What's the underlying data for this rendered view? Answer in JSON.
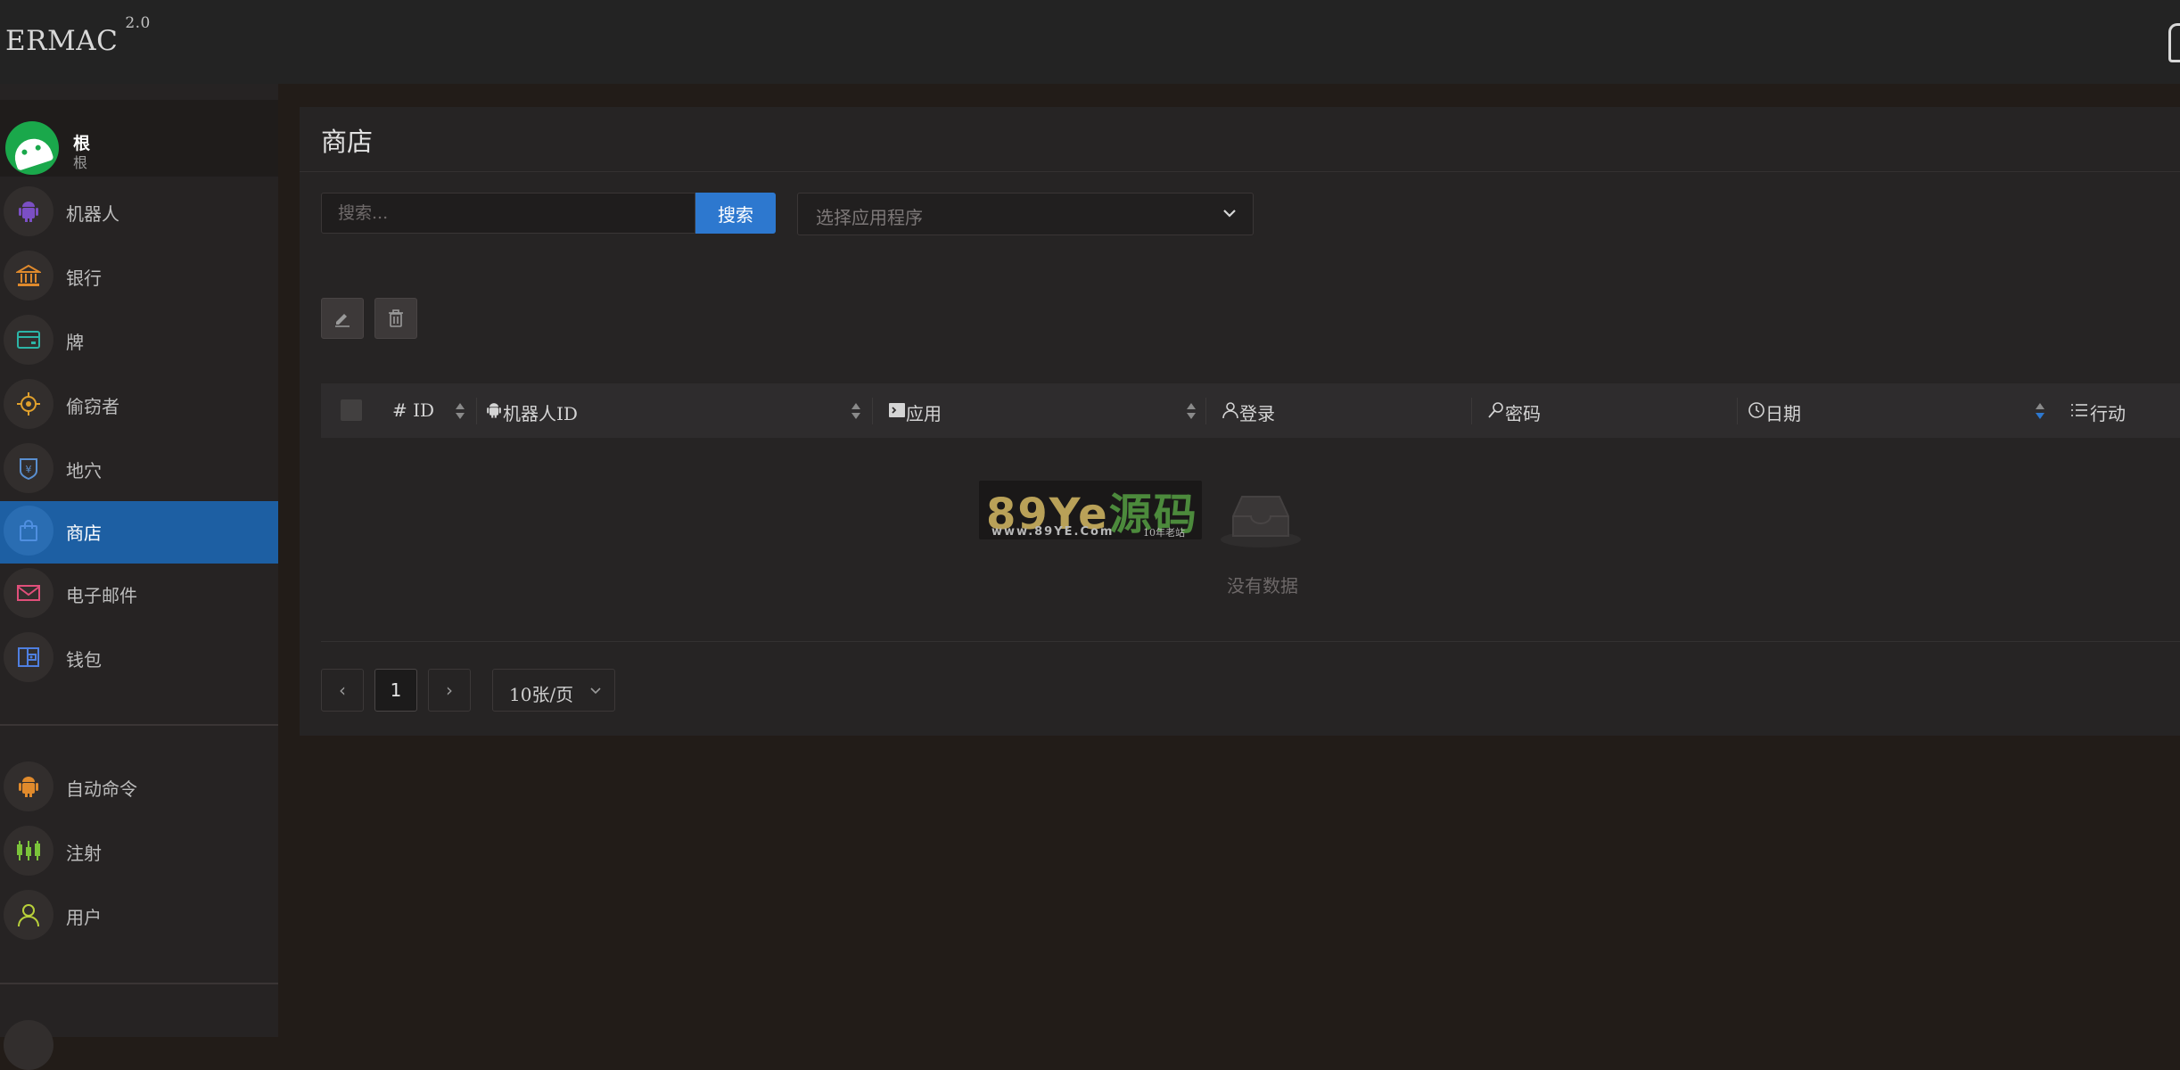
{
  "app": {
    "name": "ERMAC",
    "version": "2.0"
  },
  "profile": {
    "name": "根",
    "role": "根"
  },
  "sidebar": {
    "items": [
      {
        "label": "机器人",
        "icon": "android-icon",
        "color": "#7b4fc4"
      },
      {
        "label": "银行",
        "icon": "bank-icon",
        "color": "#e08a2c"
      },
      {
        "label": "牌",
        "icon": "card-icon",
        "color": "#2cb5a7"
      },
      {
        "label": "偷窃者",
        "icon": "target-icon",
        "color": "#e0a02c"
      },
      {
        "label": "地穴",
        "icon": "shield-yen-icon",
        "color": "#5a8fd0"
      },
      {
        "label": "商店",
        "icon": "shopping-bag-icon",
        "color": "#4f8fe0",
        "active": true
      },
      {
        "label": "电子邮件",
        "icon": "mail-icon",
        "color": "#e04f7a"
      },
      {
        "label": "钱包",
        "icon": "wallet-icon",
        "color": "#4f7fe0"
      }
    ],
    "items2": [
      {
        "label": "自动命令",
        "icon": "android-icon",
        "color": "#e08a2c"
      },
      {
        "label": "注射",
        "icon": "injection-icon",
        "color": "#7bc43a"
      },
      {
        "label": "用户",
        "icon": "user-icon",
        "color": "#b8d03a"
      }
    ]
  },
  "page": {
    "title": "商店"
  },
  "search": {
    "placeholder": "搜索...",
    "button": "搜索"
  },
  "app_select": {
    "placeholder": "选择应用程序"
  },
  "table": {
    "columns": [
      "ID",
      "机器人ID",
      "应用",
      "登录",
      "密码",
      "日期",
      "行动"
    ],
    "rows": [],
    "empty_text": "没有数据"
  },
  "watermark": {
    "main_a": "89Ye",
    "main_b": "源码",
    "url": "www.89YE.Com",
    "tag": "10年老站"
  },
  "pagination": {
    "current_page": "1",
    "page_size": "10张/页"
  },
  "colors": {
    "accent": "#2d78cf",
    "active_nav": "#1d5fa3",
    "sort_active": "#2d78cf"
  }
}
